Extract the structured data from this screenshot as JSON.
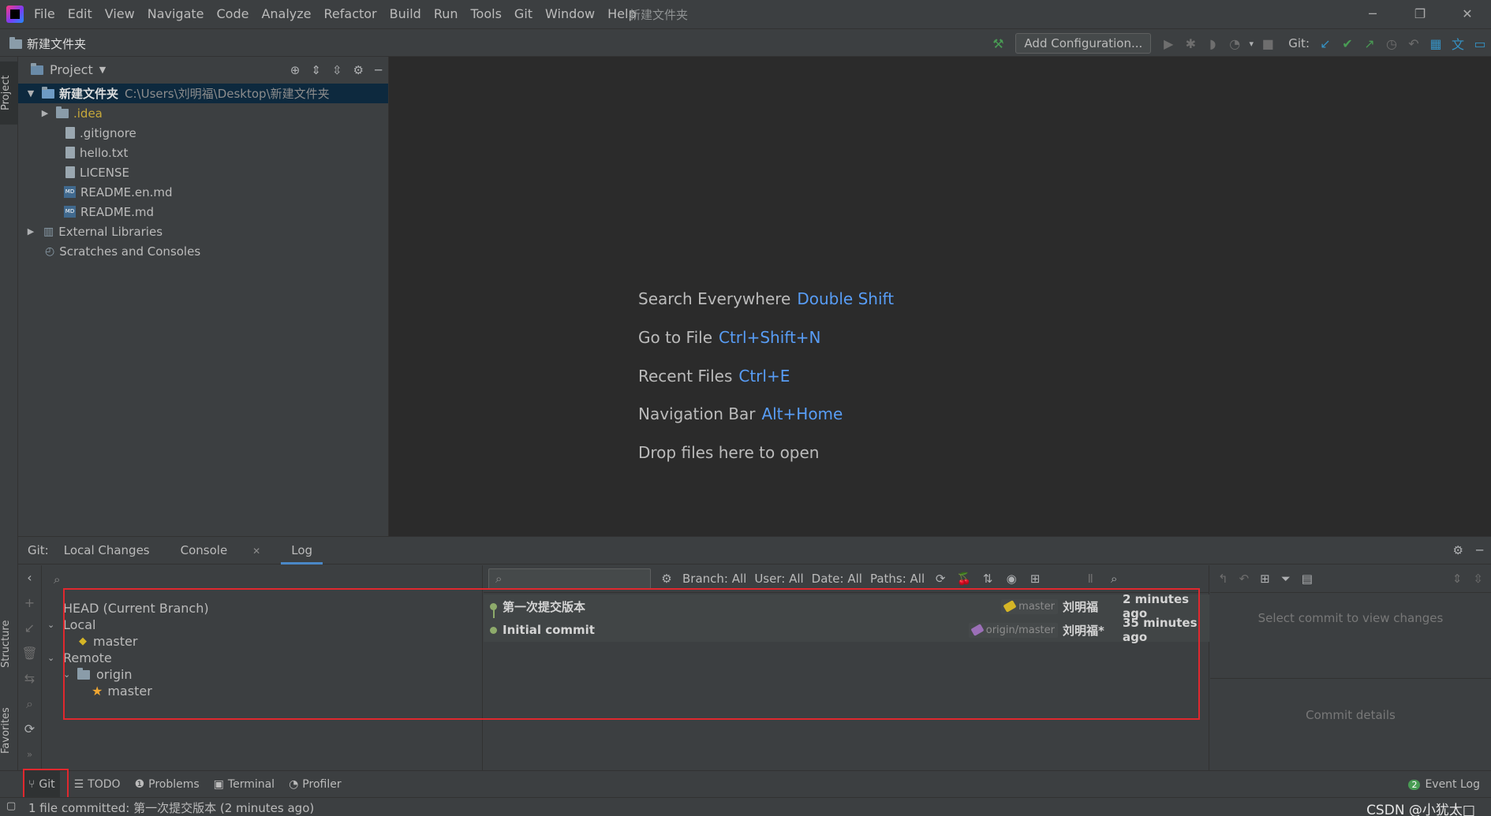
{
  "window": {
    "title": "新建文件夹",
    "minimize": "─",
    "restore": "❐",
    "close": "✕"
  },
  "menu": [
    "File",
    "Edit",
    "View",
    "Navigate",
    "Code",
    "Analyze",
    "Refactor",
    "Build",
    "Run",
    "Tools",
    "Git",
    "Window",
    "Help"
  ],
  "navbar": {
    "breadcrumb": "新建文件夹",
    "add_configuration": "Add Configuration...",
    "git_label": "Git:"
  },
  "left_tabs": {
    "project": "Project",
    "structure": "Structure",
    "favorites": "Favorites"
  },
  "project": {
    "header": "Project",
    "root": {
      "name": "新建文件夹",
      "path": "C:\\Users\\刘明福\\Desktop\\新建文件夹"
    },
    "items": [
      ".idea",
      ".gitignore",
      "hello.txt",
      "LICENSE",
      "README.en.md",
      "README.md"
    ],
    "external": "External Libraries",
    "scratches": "Scratches and Consoles"
  },
  "editor_hints": [
    {
      "label": "Search Everywhere",
      "key": "Double Shift"
    },
    {
      "label": "Go to File",
      "key": "Ctrl+Shift+N"
    },
    {
      "label": "Recent Files",
      "key": "Ctrl+E"
    },
    {
      "label": "Navigation Bar",
      "key": "Alt+Home"
    },
    {
      "label": "Drop files here to open",
      "key": ""
    }
  ],
  "git": {
    "label": "Git:",
    "tabs": [
      "Local Changes",
      "Console",
      "Log"
    ],
    "active_tab": "Log",
    "branches": {
      "head": "HEAD (Current Branch)",
      "local": "Local",
      "local_master": "master",
      "remote": "Remote",
      "origin": "origin",
      "remote_master": "master"
    },
    "filters": {
      "branch": "Branch: All",
      "user": "User: All",
      "date": "Date: All",
      "paths": "Paths: All"
    },
    "commits": [
      {
        "message": "第一次提交版本",
        "ref": "master",
        "ref_color": "#d5b526",
        "author": "刘明福",
        "date": "2 minutes ago"
      },
      {
        "message": "Initial commit",
        "ref": "origin/master",
        "ref_color": "#9b6fb7",
        "author": "刘明福*",
        "date": "35 minutes ago"
      }
    ],
    "details": {
      "select_commit": "Select commit to view changes",
      "commit_details": "Commit details"
    }
  },
  "bottom_tabs": [
    "Git",
    "TODO",
    "Problems",
    "Terminal",
    "Profiler"
  ],
  "event_log": {
    "count": "2",
    "label": "Event Log"
  },
  "status": {
    "message": "1 file committed: 第一次提交版本 (2 minutes ago)",
    "watermark": "CSDN @小犹太□"
  },
  "colors": {
    "accent": "#4a88c7",
    "highlight_box": "#e0282e",
    "graph_dot": "#8eab6b"
  }
}
